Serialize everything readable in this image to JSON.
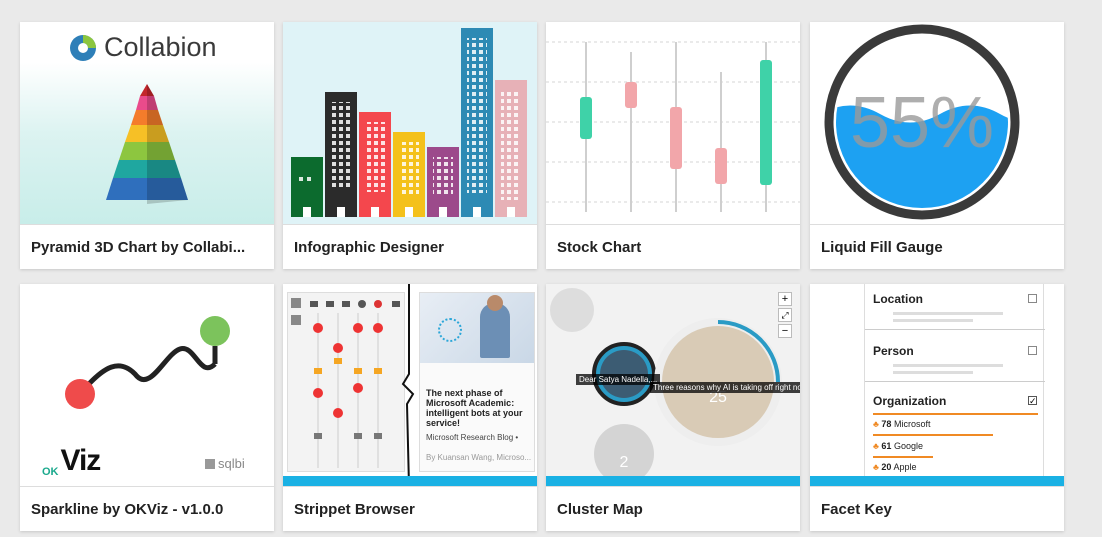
{
  "cards": [
    {
      "title": "Pyramid 3D Chart by Collabi...",
      "brand": "Collabion"
    },
    {
      "title": "Infographic Designer"
    },
    {
      "title": "Stock Chart"
    },
    {
      "title": "Liquid Fill Gauge",
      "gauge_value": "55%",
      "gauge_fill_fraction": 0.55
    },
    {
      "title": "Sparkline by OKViz - v1.0.0",
      "brand_ok": "OK",
      "brand_viz": "Viz",
      "brand_sqlbi": "sqlbi"
    },
    {
      "title": "Strippet Browser",
      "article_title": "The next phase of Microsoft Academic: intelligent bots at your service!",
      "article_source": "Microsoft Research Blog •",
      "article_author": "By Kuansan Wang, Microso..."
    },
    {
      "title": "Cluster Map",
      "node_label_left": "Dear Satya Nadella,...",
      "node_label_center": "Three reasons why AI is taking off right no...",
      "center_count": "25",
      "bottom_count": "2",
      "zoom_in": "+",
      "zoom_fit": "⤢",
      "zoom_out": "−"
    },
    {
      "title": "Facet Key",
      "facets": [
        {
          "label": "Location",
          "checked": false
        },
        {
          "label": "Person",
          "checked": false
        },
        {
          "label": "Organization",
          "checked": true
        }
      ],
      "org_values": [
        {
          "count": "78",
          "name": "Microsoft"
        },
        {
          "count": "61",
          "name": "Google"
        },
        {
          "count": "20",
          "name": "Apple"
        }
      ]
    }
  ],
  "colors": {
    "page_bg": "#eaeaea",
    "accent_teal": "#3fd2a8",
    "accent_pink": "#f2a6aa",
    "gauge_blue": "#1da1f2",
    "strip_blue": "#1ab1e4"
  }
}
